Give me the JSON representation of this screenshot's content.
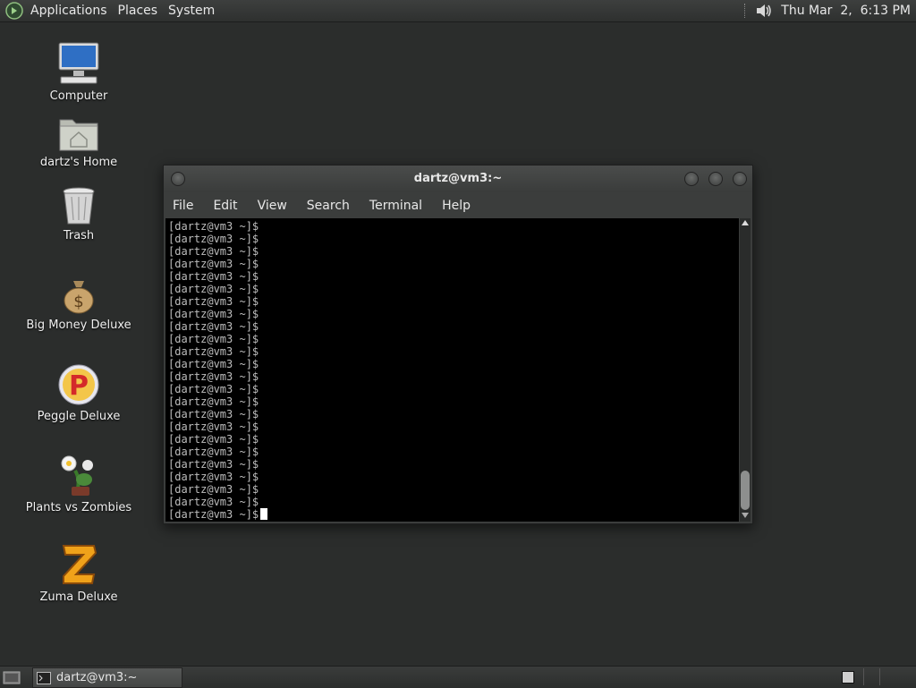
{
  "top_panel": {
    "menus": [
      "Applications",
      "Places",
      "System"
    ],
    "clock": "Thu Mar  2,  6:13 PM"
  },
  "desktop_icons": [
    {
      "label": "Computer",
      "icon": "computer-icon"
    },
    {
      "label": "dartz's Home",
      "icon": "home-folder-icon"
    },
    {
      "label": "Trash",
      "icon": "trash-icon"
    },
    {
      "label": "Big Money Deluxe",
      "icon": "money-bag-icon"
    },
    {
      "label": "Peggle Deluxe",
      "icon": "peggle-icon"
    },
    {
      "label": "Plants vs Zombies",
      "icon": "plants-vs-zombies-icon"
    },
    {
      "label": "Zuma Deluxe",
      "icon": "zuma-icon"
    }
  ],
  "terminal": {
    "title": "dartz@vm3:~",
    "menus": [
      "File",
      "Edit",
      "View",
      "Search",
      "Terminal",
      "Help"
    ],
    "prompt": "[dartz@vm3 ~]$",
    "line_count": 24
  },
  "bottom_panel": {
    "task_label": "dartz@vm3:~"
  },
  "colors": {
    "desktop": "#2b2d2c",
    "terminal_bg": "#000000",
    "terminal_fg": "#bdbdbd"
  }
}
